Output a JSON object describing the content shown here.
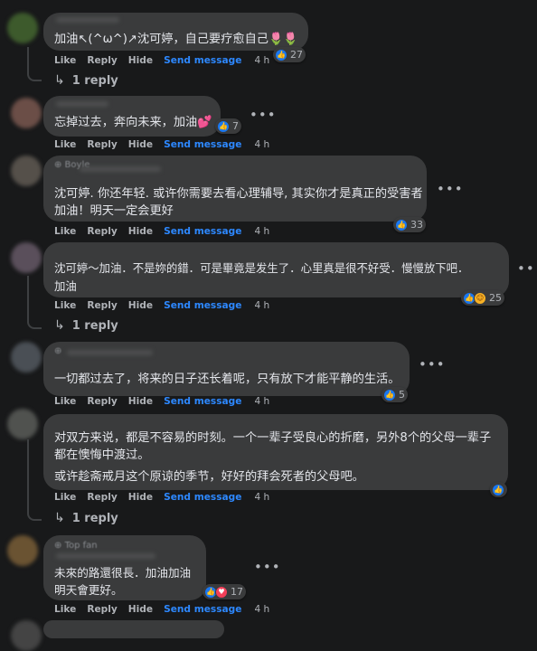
{
  "comments": [
    {
      "text": "加油↖(^ω^)↗沈可婷，自己要疗愈自己🌷🌷",
      "reactions": "27",
      "time": "4 h"
    },
    {
      "text": "忘掉过去，奔向未来，加油💕",
      "reactions": "7",
      "time": "4 h"
    },
    {
      "text": "沈可婷. 你还年轻. 或许你需要去看心理辅导, 其实你才是真正的受害者\n加油！明天一定会更好",
      "reactions": "33",
      "time": "4 h"
    },
    {
      "text": "沈可婷～加油．不是妳的錯．可是畢竟是发生了．心里真是很不好受．慢慢放下吧．\n加油",
      "reactions": "25",
      "time": "4 h"
    },
    {
      "text": "一切都过去了，将来的日子还长着呢，只有放下才能平静的生活。",
      "reactions": "5",
      "time": "4 h"
    },
    {
      "text": "对双方来说，都是不容易的时刻。一个一辈子受良心的折磨，另外8个的父母一辈子\n都在懊悔中渡过。",
      "text2": "或许趁斋戒月这个原谅的季节，好好的拜会死者的父母吧。",
      "time": "4 h"
    },
    {
      "author": "Top fan",
      "text": "未來的路還很長．加油加油\n明天會更好。",
      "reactions": "17",
      "time": "4 h"
    }
  ],
  "actions": {
    "like": "Like",
    "reply": "Reply",
    "hide": "Hide",
    "send": "Send message"
  },
  "reply_link": "1 reply",
  "menu_dots": "•••",
  "icons": {
    "like": "like-icon",
    "love": "love-icon",
    "care": "care-icon",
    "reply_arrow": "reply-arrow-icon"
  },
  "colors": {
    "background": "#18191a",
    "bubble": "#3a3b3c",
    "link": "#2d88ff",
    "like": "#1877f2",
    "love": "#f33e58"
  }
}
